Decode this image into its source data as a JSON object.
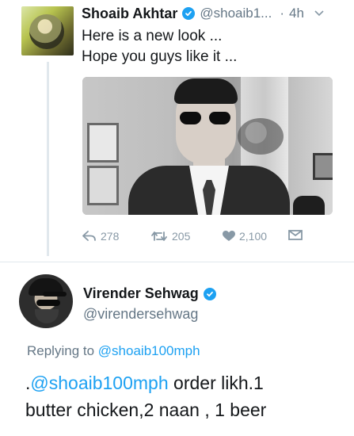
{
  "tweet": {
    "author_name": "Shoaib Akhtar",
    "handle": "@shoaib1...",
    "separator": "·",
    "time": "4h",
    "lines": [
      "Here is a new look ...",
      "Hope you guys like it ..."
    ],
    "actions": {
      "reply_count": "278",
      "retweet_count": "205",
      "like_count": "2,100"
    }
  },
  "reply": {
    "author_name": "Virender Sehwag",
    "handle": "@virendersehwag",
    "replying_to_prefix": "Replying to",
    "replying_to_mention": "@shoaib100mph",
    "text_prefix": ".",
    "text_mention": "@shoaib100mph",
    "text_line1_rest": " order likh.1",
    "text_line2": "butter chicken,2 naan , 1 beer"
  },
  "colors": {
    "accent_blue": "#1da1f2",
    "secondary_text": "#657786",
    "action_gray": "#8899a6"
  },
  "icons": {
    "verified": "verified-badge-icon",
    "chevron": "chevron-down-icon",
    "reply": "reply-arrow-icon",
    "retweet": "retweet-icon",
    "like": "heart-icon",
    "dm": "envelope-icon"
  }
}
